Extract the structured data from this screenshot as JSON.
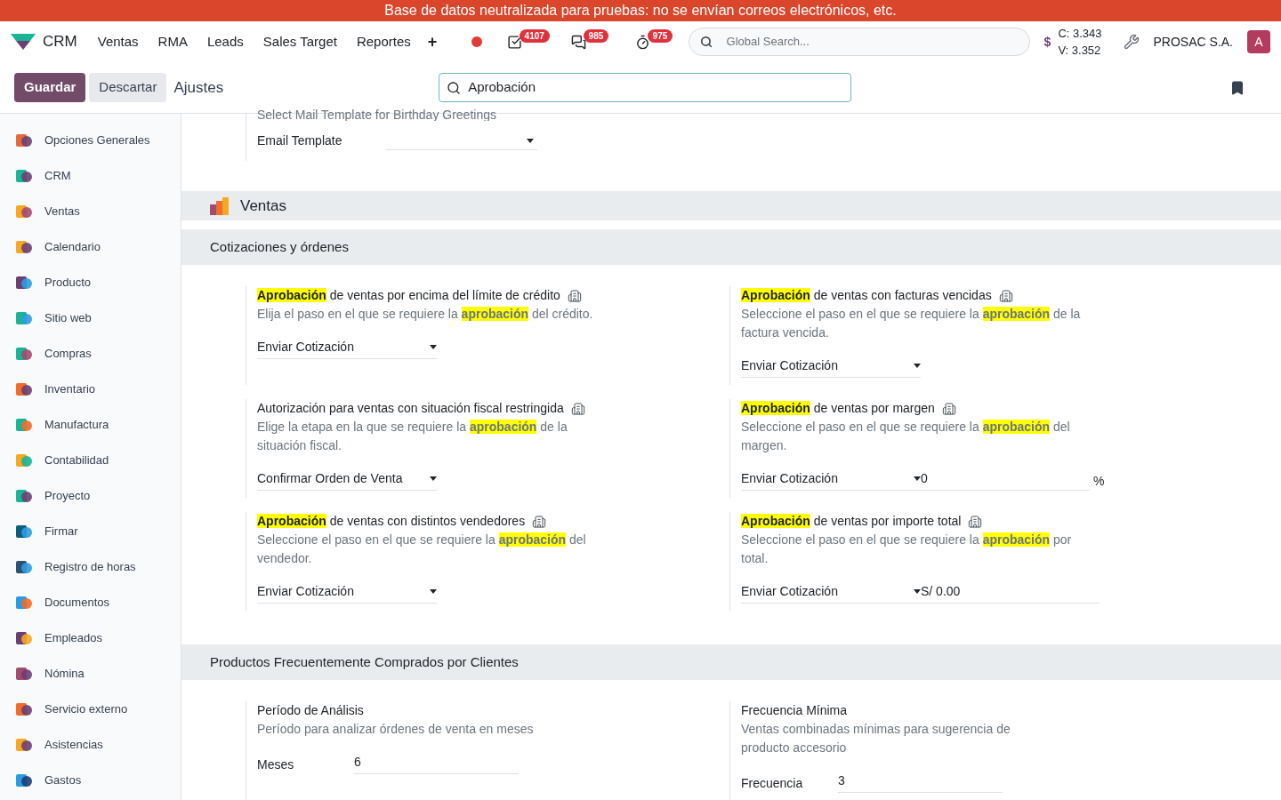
{
  "banner": "Base de datos neutralizada para pruebas: no se envían correos electrónicos, etc.",
  "nav": {
    "app": "CRM",
    "menu": [
      "Ventas",
      "RMA",
      "Leads",
      "Sales Target",
      "Reportes"
    ],
    "add": "+",
    "badges": [
      {
        "kind": "activity",
        "count": "4107"
      },
      {
        "kind": "chat",
        "count": "985"
      },
      {
        "kind": "timer",
        "count": "975"
      }
    ],
    "search": {
      "placeholder": "Global Search..."
    },
    "currency": "$",
    "rates": [
      "C: 3.343",
      "V: 3.352"
    ],
    "company": "PROSAC S.A.",
    "avatar": "A"
  },
  "control": {
    "save": "Guardar",
    "discard": "Descartar",
    "title": "Ajustes",
    "search": "Aprobación"
  },
  "sidebar": {
    "items": [
      {
        "label": "Opciones Generales",
        "selected": false
      },
      {
        "label": "CRM",
        "selected": false
      },
      {
        "label": "Ventas",
        "selected": false
      },
      {
        "label": "Calendario",
        "selected": false
      },
      {
        "label": "Producto",
        "selected": false
      },
      {
        "label": "Sitio web",
        "selected": false
      },
      {
        "label": "Compras",
        "selected": false
      },
      {
        "label": "Inventario",
        "selected": false
      },
      {
        "label": "Manufactura",
        "selected": false
      },
      {
        "label": "Contabilidad",
        "selected": false
      },
      {
        "label": "Proyecto",
        "selected": false
      },
      {
        "label": "Firmar",
        "selected": false
      },
      {
        "label": "Registro de horas",
        "selected": false
      },
      {
        "label": "Documentos",
        "selected": false
      },
      {
        "label": "Empleados",
        "selected": false
      },
      {
        "label": "Nómina",
        "selected": false
      },
      {
        "label": "Servicio externo",
        "selected": false
      },
      {
        "label": "Asistencias",
        "selected": false
      },
      {
        "label": "Gastos",
        "selected": false
      }
    ]
  },
  "top_setting": {
    "description": "Select Mail Template for Birthday Greetings",
    "label": "Email Template"
  },
  "app_section": "Ventas",
  "sections": [
    {
      "title": "Cotizaciones y órdenes",
      "settings": [
        {
          "title": [
            {
              "text": "Aprobación",
              "highlight": true
            },
            {
              "text": " de ventas por encima del límite de crédito",
              "highlight": false
            }
          ],
          "description": [
            {
              "text": "Elija el paso en el que se requiere la ",
              "highlight": false
            },
            {
              "text": "aprobación",
              "highlight": true
            },
            {
              "text": " del crédito.",
              "highlight": false
            }
          ],
          "kind": "select",
          "value": "Enviar Cotización"
        },
        {
          "title": [
            {
              "text": "Aprobación",
              "highlight": true
            },
            {
              "text": " de ventas con facturas vencidas",
              "highlight": false
            }
          ],
          "description": [
            {
              "text": "Seleccione el paso en el que se requiere la ",
              "highlight": false
            },
            {
              "text": "aprobación",
              "highlight": true
            },
            {
              "text": " de la factura vencida.",
              "highlight": false
            }
          ],
          "kind": "select",
          "value": "Enviar Cotización"
        },
        {
          "title": [
            {
              "text": "Autorización para ventas con situación fiscal restringida",
              "highlight": false
            }
          ],
          "description": [
            {
              "text": "Elige la etapa en la que se requiere la ",
              "highlight": false
            },
            {
              "text": "aprobación",
              "highlight": true
            },
            {
              "text": " de la situación fiscal.",
              "highlight": false
            }
          ],
          "kind": "select",
          "value": "Confirmar Orden de Venta"
        },
        {
          "title": [
            {
              "text": "Aprobación",
              "highlight": true
            },
            {
              "text": " de ventas por margen",
              "highlight": false
            }
          ],
          "description": [
            {
              "text": "Seleccione el paso en el que se requiere la ",
              "highlight": false
            },
            {
              "text": "aprobación",
              "highlight": true
            },
            {
              "text": " del margen.",
              "highlight": false
            }
          ],
          "kind": "select_number",
          "value": "Enviar Cotización",
          "amount": "0",
          "suffix": "%"
        },
        {
          "title": [
            {
              "text": "Aprobación",
              "highlight": true
            },
            {
              "text": " de ventas con distintos vendedores",
              "highlight": false
            }
          ],
          "description": [
            {
              "text": "Seleccione el paso en el que se requiere la ",
              "highlight": false
            },
            {
              "text": "aprobación",
              "highlight": true
            },
            {
              "text": " del vendedor.",
              "highlight": false
            }
          ],
          "kind": "select",
          "value": "Enviar Cotización"
        },
        {
          "title": [
            {
              "text": "Aprobación",
              "highlight": true
            },
            {
              "text": " de ventas por importe total",
              "highlight": false
            }
          ],
          "description": [
            {
              "text": "Seleccione el paso en el que se requiere la ",
              "highlight": false
            },
            {
              "text": "aprobación",
              "highlight": true
            },
            {
              "text": " por total.",
              "highlight": false
            }
          ],
          "kind": "select_money",
          "value": "Enviar Cotización",
          "amount": "S/ 0.00"
        }
      ]
    },
    {
      "title": "Productos Frecuentemente Comprados por Clientes",
      "settings": [
        {
          "title": [
            {
              "text": "Período de Análisis",
              "highlight": false
            }
          ],
          "description": [
            {
              "text": "Período para analizar órdenes de venta en meses",
              "highlight": false
            }
          ],
          "kind": "labeled_input",
          "label": "Meses",
          "value": "6"
        },
        {
          "title": [
            {
              "text": "Frecuencia Mínima",
              "highlight": false
            }
          ],
          "description": [
            {
              "text": "Ventas combinadas mínimas para sugerencia de producto accesorio",
              "highlight": false
            }
          ],
          "kind": "labeled_input",
          "label": "Frecuencia",
          "value": "3"
        }
      ]
    }
  ]
}
